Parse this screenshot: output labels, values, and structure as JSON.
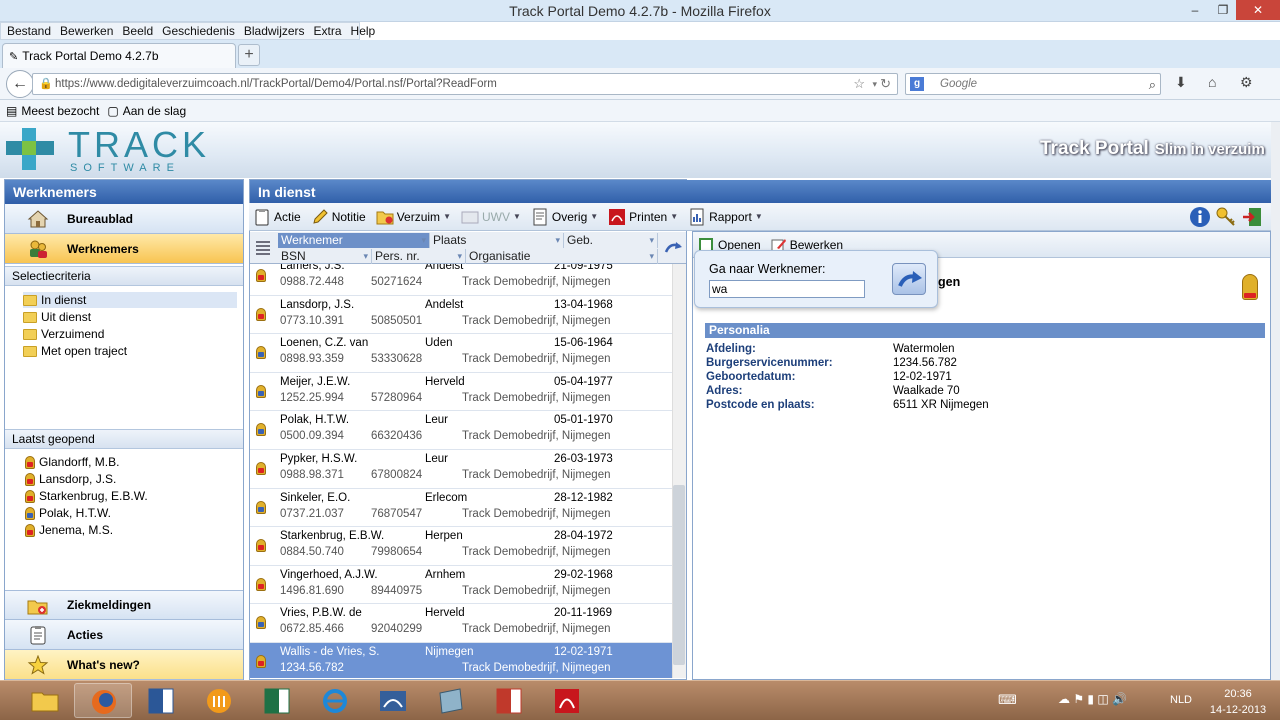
{
  "window": {
    "title": "Track Portal Demo 4.2.7b - Mozilla Firefox"
  },
  "menu": [
    "Bestand",
    "Bewerken",
    "Beeld",
    "Geschiedenis",
    "Bladwijzers",
    "Extra",
    "Help"
  ],
  "tab": {
    "label": "Track Portal Demo 4.2.7b"
  },
  "address": {
    "url": "https://www.dedigitaleverzuimcoach.nl/TrackPortal/Demo4/Portal.nsf/Portal?ReadForm",
    "search_placeholder": "Google"
  },
  "bookmarks": [
    "Meest bezocht",
    "Aan de slag"
  ],
  "app": {
    "logo_main": "TRACK",
    "logo_sub": "SOFTWARE",
    "title": "Track Portal",
    "slogan": "Slim in verzuim"
  },
  "left": {
    "header": "Werknemers",
    "nav_top": [
      {
        "label": "Bureaublad"
      },
      {
        "label": "Werknemers"
      }
    ],
    "selectie_title": "Selectiecriteria",
    "selectie": [
      "In dienst",
      "Uit dienst",
      "Verzuimend",
      "Met open traject"
    ],
    "recent_title": "Laatst geopend",
    "recent": [
      "Glandorff, M.B.",
      "Lansdorp, J.S.",
      "Starkenbrug, E.B.W.",
      "Polak, H.T.W.",
      "Jenema, M.S."
    ],
    "nav_bottom": [
      {
        "label": "Ziekmeldingen"
      },
      {
        "label": "Acties"
      },
      {
        "label": "What's new?"
      }
    ]
  },
  "center": {
    "header": "In dienst",
    "toolbar": [
      "Actie",
      "Notitie",
      "Verzuim",
      "UWV",
      "Overig",
      "Printen",
      "Rapport"
    ],
    "columns_top": [
      "Werknemer",
      "Plaats",
      "Geb."
    ],
    "columns_bottom": [
      "BSN",
      "Pers. nr.",
      "Organisatie"
    ],
    "rows": [
      {
        "name": "Lamers, J.S.",
        "place": "Andelst",
        "dob": "21-09-1975",
        "bsn": "0988.72.448",
        "pers": "50271624",
        "org": "Track Demobedrijf, Nijmegen",
        "icon": "red"
      },
      {
        "name": "Lansdorp, J.S.",
        "place": "Andelst",
        "dob": "13-04-1968",
        "bsn": "0773.10.391",
        "pers": "50850501",
        "org": "Track Demobedrijf, Nijmegen",
        "icon": "red"
      },
      {
        "name": "Loenen, C.Z. van",
        "place": "Uden",
        "dob": "15-06-1964",
        "bsn": "0898.93.359",
        "pers": "53330628",
        "org": "Track Demobedrijf, Nijmegen",
        "icon": "blue"
      },
      {
        "name": "Meijer, J.E.W.",
        "place": "Herveld",
        "dob": "05-04-1977",
        "bsn": "1252.25.994",
        "pers": "57280964",
        "org": "Track Demobedrijf, Nijmegen",
        "icon": "blue"
      },
      {
        "name": "Polak, H.T.W.",
        "place": "Leur",
        "dob": "05-01-1970",
        "bsn": "0500.09.394",
        "pers": "66320436",
        "org": "Track Demobedrijf, Nijmegen",
        "icon": "blue"
      },
      {
        "name": "Pypker, H.S.W.",
        "place": "Leur",
        "dob": "26-03-1973",
        "bsn": "0988.98.371",
        "pers": "67800824",
        "org": "Track Demobedrijf, Nijmegen",
        "icon": "red"
      },
      {
        "name": "Sinkeler, E.O.",
        "place": "Erlecom",
        "dob": "28-12-1982",
        "bsn": "0737.21.037",
        "pers": "76870547",
        "org": "Track Demobedrijf, Nijmegen",
        "icon": "blue"
      },
      {
        "name": "Starkenbrug, E.B.W.",
        "place": "Herpen",
        "dob": "28-04-1972",
        "bsn": "0884.50.740",
        "pers": "79980654",
        "org": "Track Demobedrijf, Nijmegen",
        "icon": "red"
      },
      {
        "name": "Vingerhoed, A.J.W.",
        "place": "Arnhem",
        "dob": "29-02-1968",
        "bsn": "1496.81.690",
        "pers": "89440975",
        "org": "Track Demobedrijf, Nijmegen",
        "icon": "red"
      },
      {
        "name": "Vries, P.B.W. de",
        "place": "Herveld",
        "dob": "20-11-1969",
        "bsn": "0672.85.466",
        "pers": "92040299",
        "org": "Track Demobedrijf, Nijmegen",
        "icon": "blue"
      },
      {
        "name": "Wallis - de Vries, S.",
        "place": "Nijmegen",
        "dob": "12-02-1971",
        "bsn": "1234.56.782",
        "pers": "",
        "org": "Track Demobedrijf, Nijmegen",
        "icon": "red",
        "selected": true
      }
    ]
  },
  "right": {
    "toolbar": [
      "Openen",
      "Bewerken"
    ],
    "name_suffix": "gen",
    "popup": {
      "label": "Ga naar Werknemer:",
      "value": "wa"
    },
    "section": "Personalia",
    "fields": [
      {
        "label": "Afdeling:",
        "value": "Watermolen"
      },
      {
        "label": "Burgerservicenummer:",
        "value": "1234.56.782"
      },
      {
        "label": "Geboortedatum:",
        "value": "12-02-1971"
      },
      {
        "label": "Adres:",
        "value": "Waalkade 70"
      },
      {
        "label": "Postcode en plaats:",
        "value": "6511 XR Nijmegen"
      }
    ]
  },
  "taskbar": {
    "lang": "NLD",
    "time": "20:36",
    "date": "14-12-2013"
  }
}
